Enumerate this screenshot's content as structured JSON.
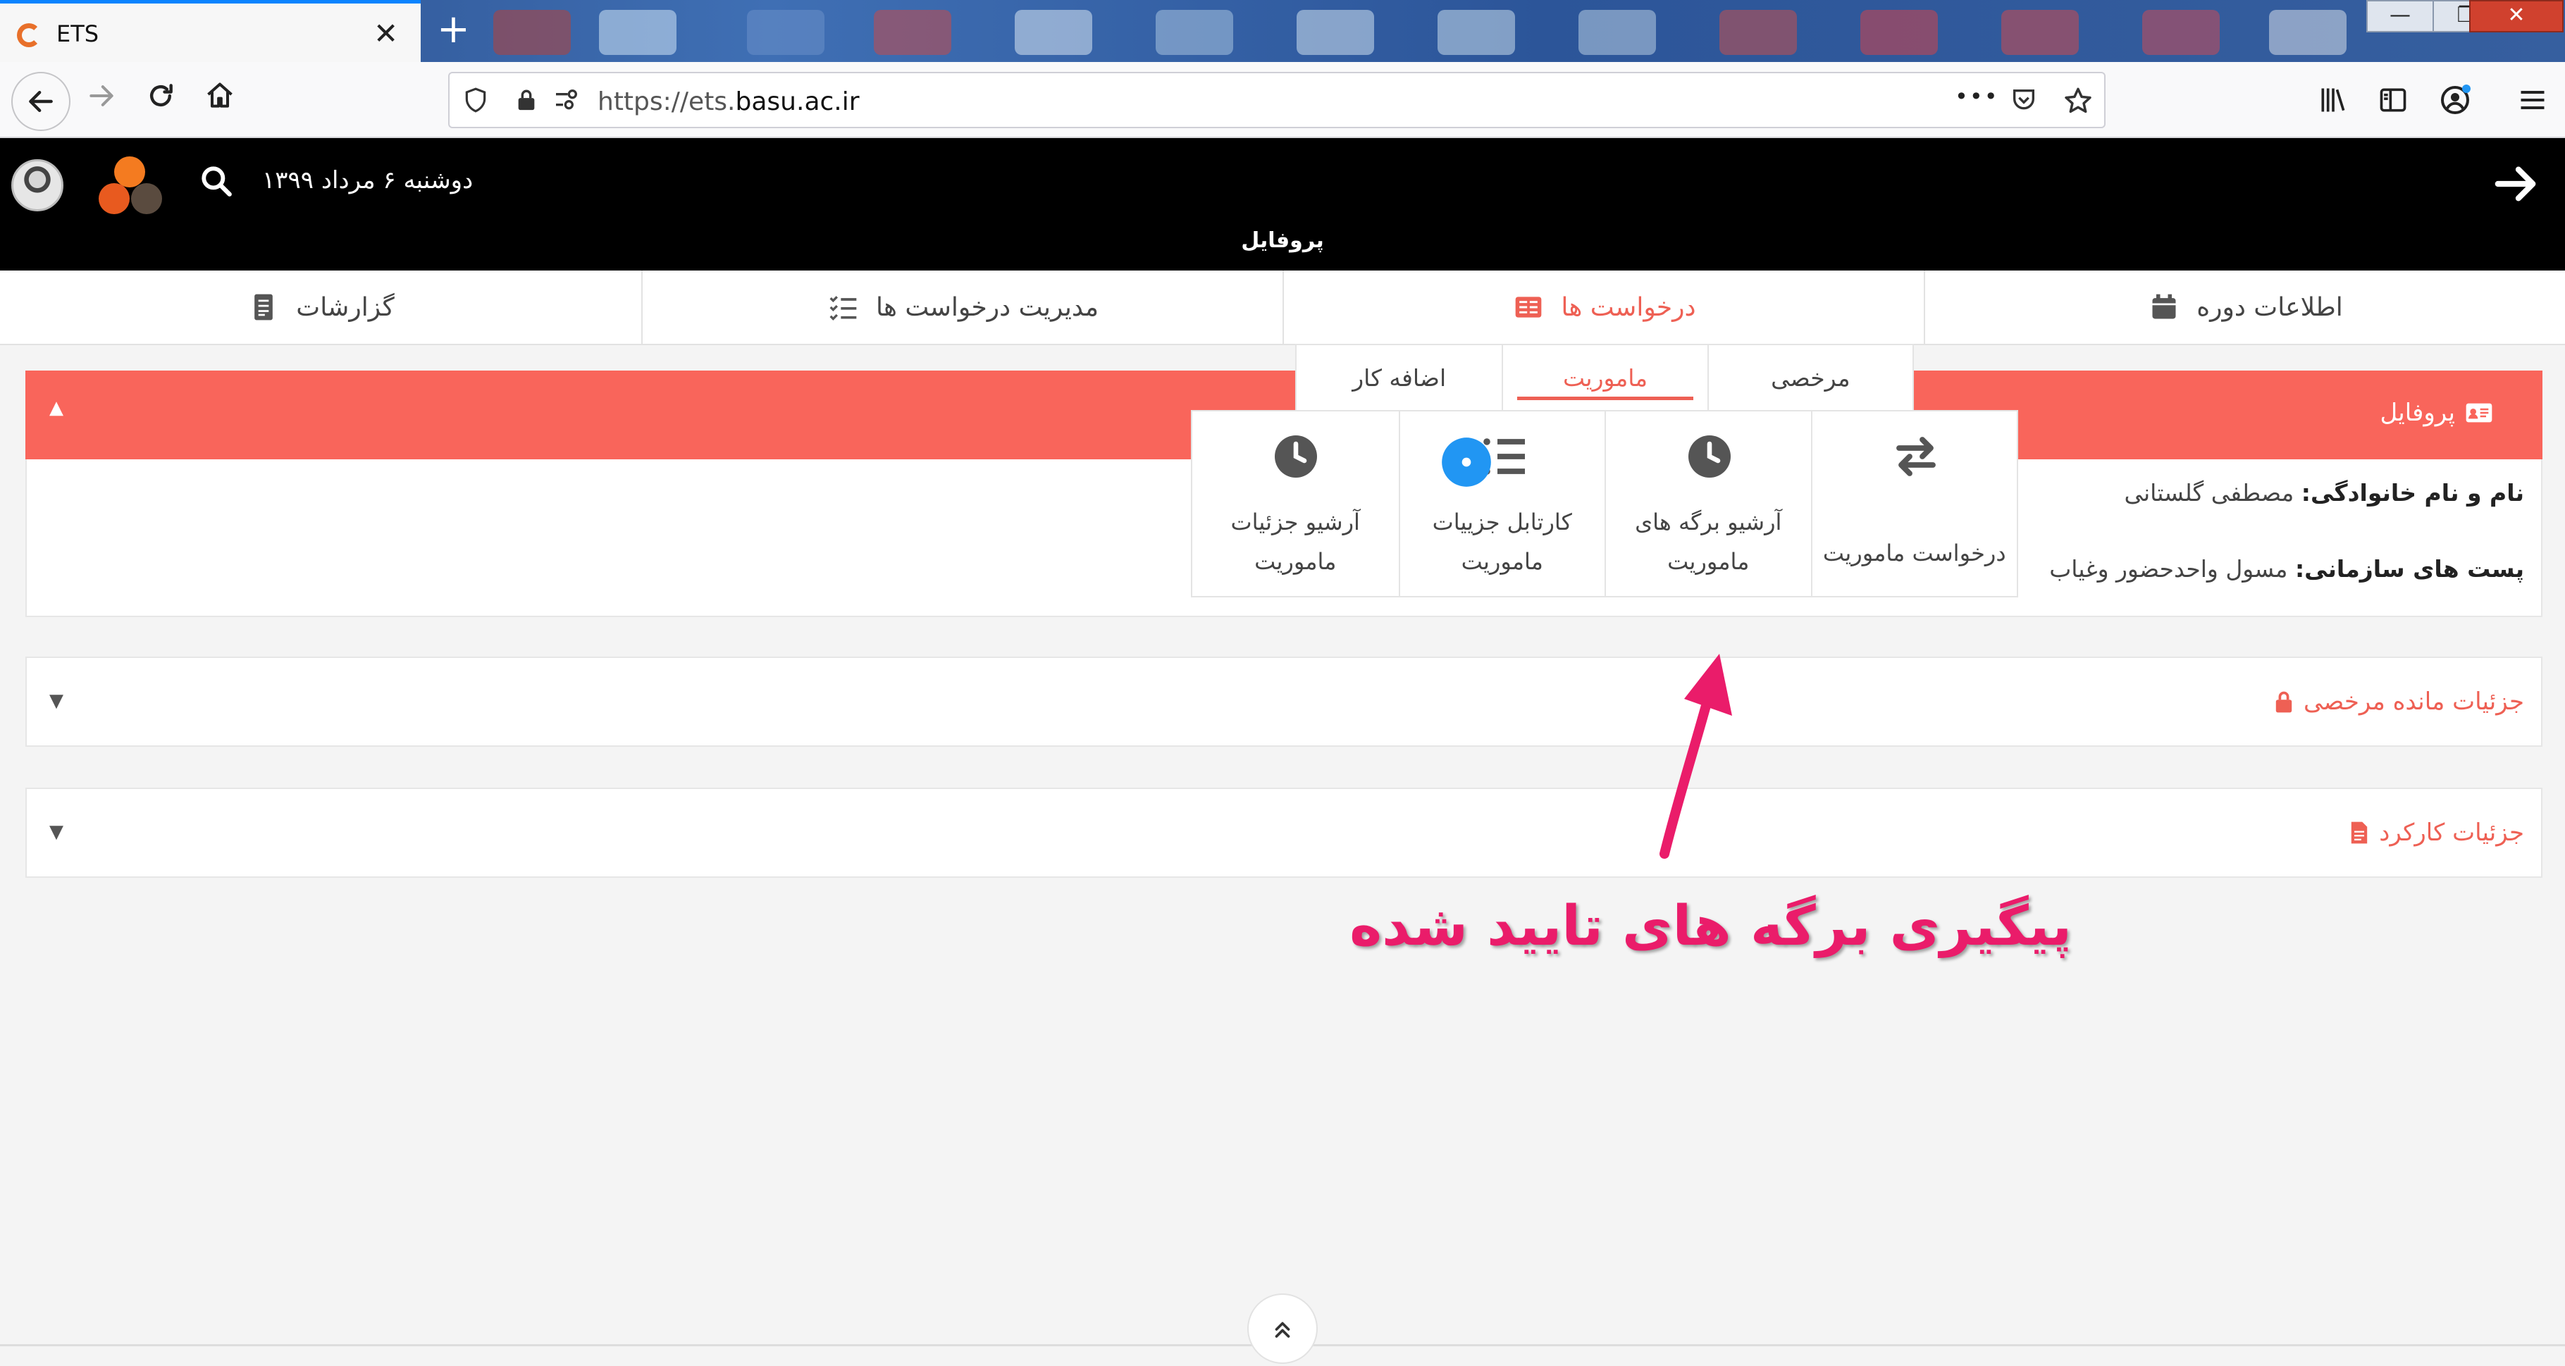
{
  "browser": {
    "tab_title": "ETS",
    "tab_close": "✕",
    "new_tab": "+",
    "url_prefix": "https://ets.",
    "url_domain": "basu.ac.ir",
    "url_more": "•••",
    "win_min": "—",
    "win_max": "❐",
    "win_close": "✕"
  },
  "header": {
    "date": "دوشنبه ۶ مرداد ۱۳۹۹",
    "page_label": "پروفایل",
    "logo_colors": [
      "#f47b20",
      "#e85a1f",
      "#5a4b3f"
    ]
  },
  "main_tabs": [
    {
      "label": "اطلاعات دوره",
      "icon": "calendar-icon"
    },
    {
      "label": "درخواست ها",
      "icon": "requests-icon"
    },
    {
      "label": "مدیریت درخواست ها",
      "icon": "list-check-icon"
    },
    {
      "label": "گزارشات",
      "icon": "report-icon"
    }
  ],
  "submenu": {
    "tabs": [
      {
        "label": "مرخصی"
      },
      {
        "label": "ماموریت"
      },
      {
        "label": "اضافه کار"
      }
    ],
    "cards": [
      {
        "line1": "درخواست ماموریت",
        "line2": "",
        "icon": "exchange-icon"
      },
      {
        "line1": "آرشیو برگه های",
        "line2": "ماموریت",
        "icon": "clock-icon"
      },
      {
        "line1": "کارتابل جزییات",
        "line2": "ماموریت",
        "icon": "list-icon"
      },
      {
        "line1": "آرشیو جزئیات",
        "line2": "ماموریت",
        "icon": "clock-icon"
      }
    ]
  },
  "profile": {
    "title": "پروفایل",
    "name_label": "نام و نام خانوادگی:",
    "name_value": "مصطفی گلستانی",
    "post_label": "پست های سازمانی:",
    "post_value": "مسول واحدحضور وغیاب"
  },
  "sections": [
    {
      "title": "جزئیات مانده مرخصی",
      "icon": "lock-icon"
    },
    {
      "title": "جزئیات کارکرد",
      "icon": "document-icon"
    }
  ],
  "annotation": {
    "text": "پیگیری برگه های تایید شده",
    "color": "#ea1c6a"
  },
  "colors": {
    "accent": "#f9655b",
    "accent_text": "#ee6054",
    "header_bg": "#000000",
    "notification_dot": "#2196f3"
  }
}
